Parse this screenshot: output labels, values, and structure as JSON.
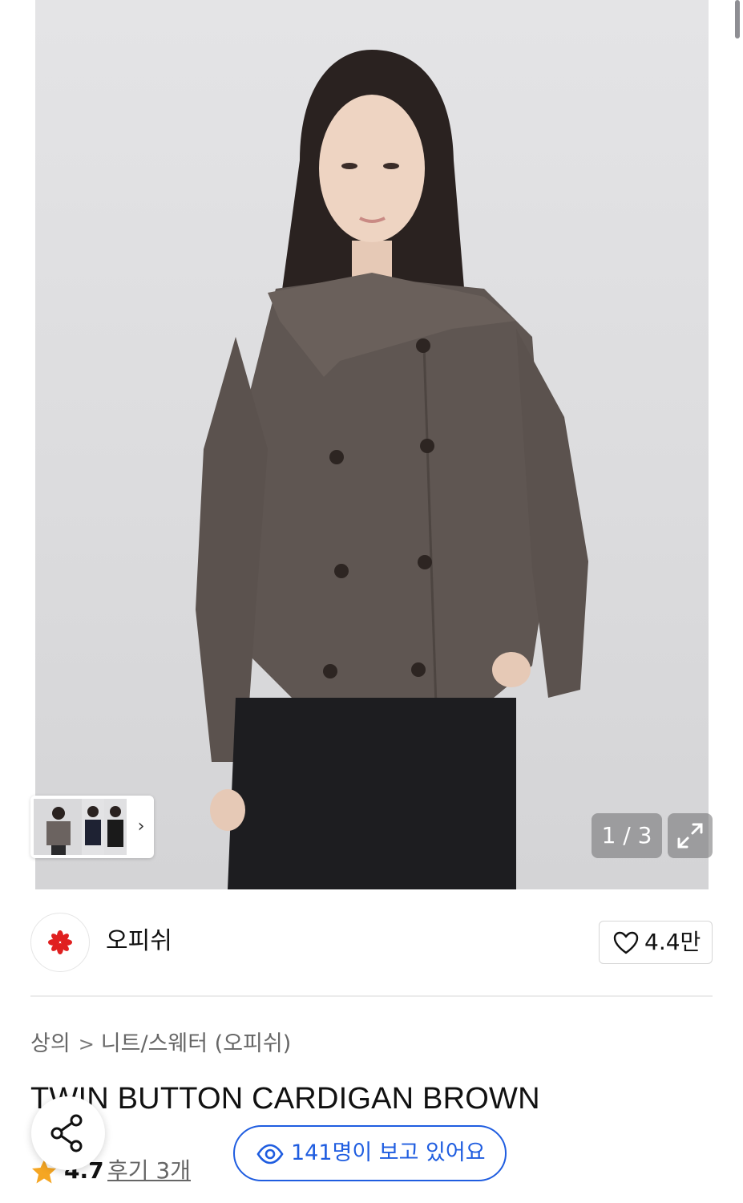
{
  "gallery": {
    "counter": "1 / 3",
    "next_label": "›"
  },
  "brand": {
    "name": "오피쉬",
    "like_count": "4.4만"
  },
  "breadcrumb": {
    "category": "상의",
    "separator": ">",
    "subcategory": "니트/스웨터 (오피쉬)"
  },
  "product": {
    "title": "TWIN BUTTON CARDIGAN BROWN",
    "rating": "4.7",
    "review_link": "후기 3개"
  },
  "viewers": {
    "text": "141명이 보고 있어요"
  },
  "colors": {
    "accent_blue": "#1f5de0",
    "star": "#f5a623",
    "brand_red": "#e02020"
  },
  "icons": [
    "expand-icon",
    "heart-icon",
    "eye-icon",
    "share-icon",
    "star-icon",
    "chevron-right-icon",
    "brand-logo"
  ]
}
